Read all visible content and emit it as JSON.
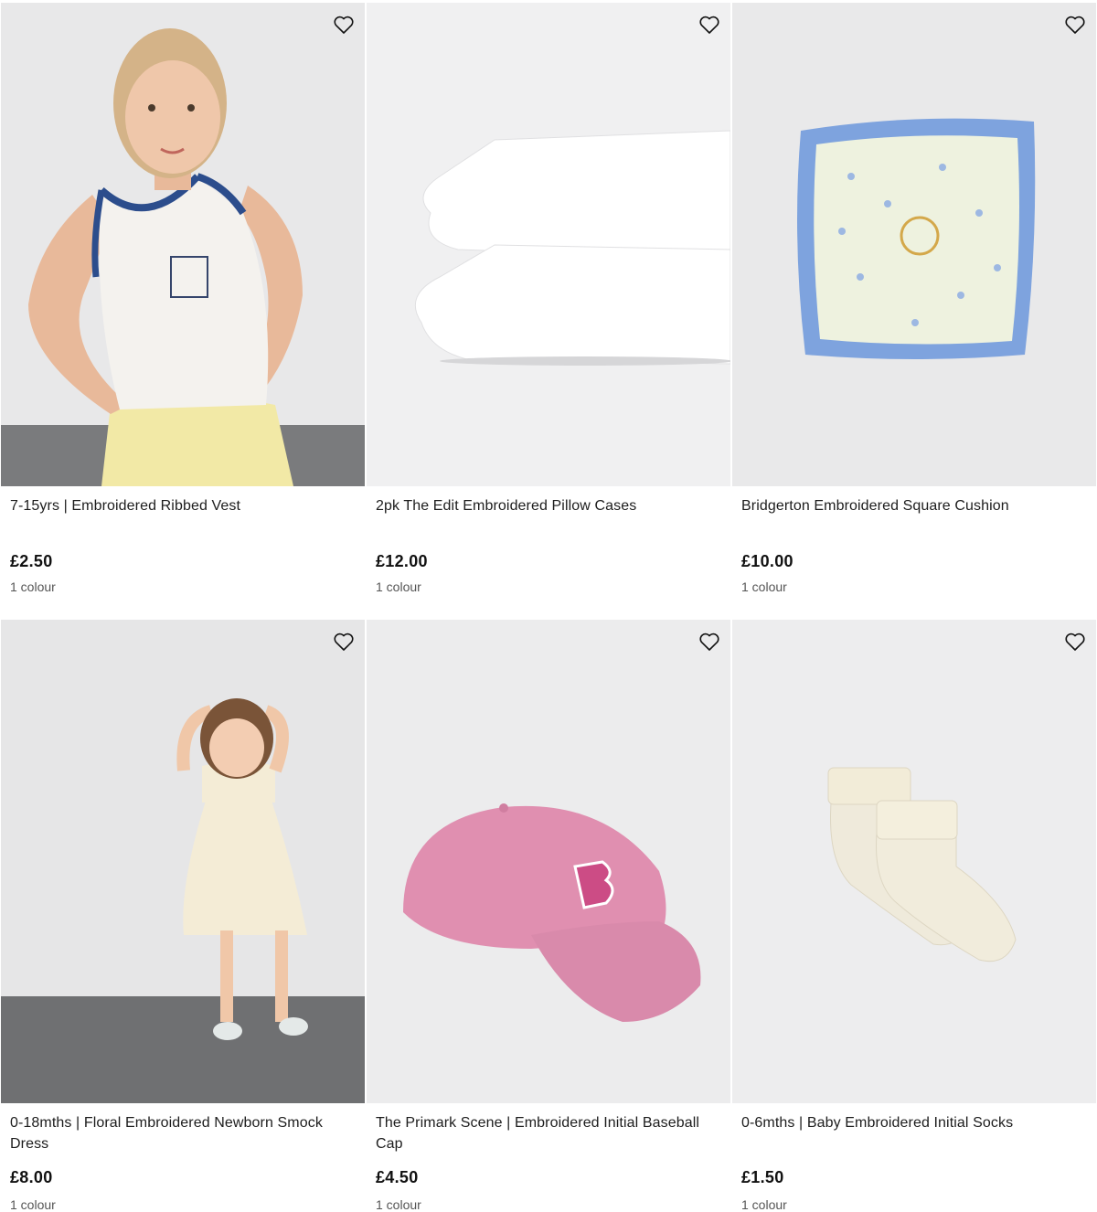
{
  "products": [
    {
      "title": "7-15yrs | Embroidered Ribbed Vest",
      "price": "£2.50",
      "colours": "1 colour"
    },
    {
      "title": "2pk The Edit Embroidered Pillow Cases",
      "price": "£12.00",
      "colours": "1 colour"
    },
    {
      "title": "Bridgerton Embroidered Square Cushion",
      "price": "£10.00",
      "colours": "1 colour"
    },
    {
      "title": "0-18mths | Floral Embroidered Newborn Smock Dress",
      "price": "£8.00",
      "colours": "1 colour"
    },
    {
      "title": "The Primark Scene | Embroidered Initial Baseball Cap",
      "price": "£4.50",
      "colours": "1 colour"
    },
    {
      "title": "0-6mths | Baby Embroidered Initial Socks",
      "price": "£1.50",
      "colours": "1 colour"
    }
  ],
  "icons": {
    "favourite": "heart-outline-icon"
  },
  "colors": {
    "image_bg": "#ededee",
    "text": "#1d1d1d",
    "muted": "#555555"
  }
}
